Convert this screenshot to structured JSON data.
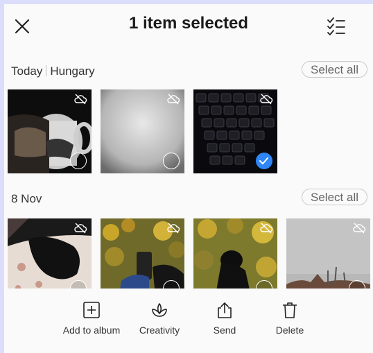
{
  "header": {
    "title": "1 item selected"
  },
  "sections": [
    {
      "title_date": "Today",
      "title_place": "Hungary",
      "select_all_label": "Select all"
    },
    {
      "title_date": "8 Nov",
      "title_place": "",
      "select_all_label": "Select all"
    }
  ],
  "toolbar": {
    "items": [
      {
        "label": "Add to album"
      },
      {
        "label": "Creativity"
      },
      {
        "label": "Send"
      },
      {
        "label": "Delete"
      }
    ]
  },
  "colors": {
    "accent": "#2f86f6",
    "frame": "#dcdcfb",
    "background": "#fafafa"
  }
}
